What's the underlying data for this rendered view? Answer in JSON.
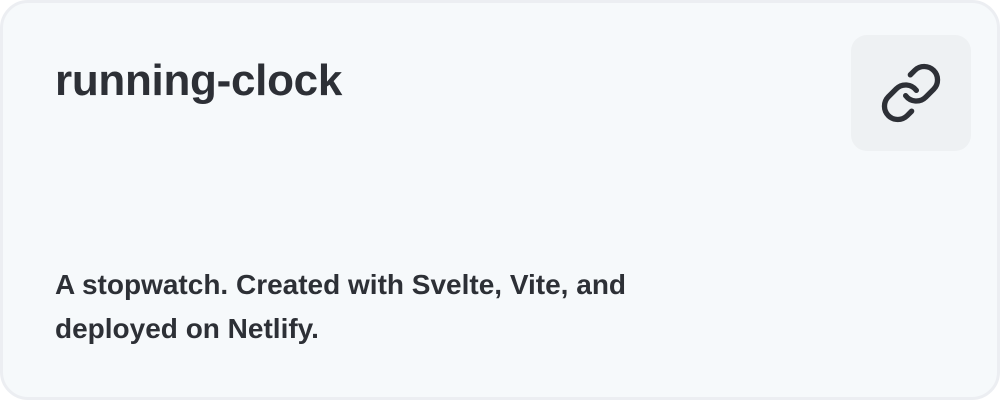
{
  "card": {
    "title": "running-clock",
    "description": "A stopwatch. Created with Svelte, Vite, and deployed on Netlify.",
    "link_icon": "link-icon"
  },
  "colors": {
    "card_background": "#f6f9fb",
    "card_border": "#eceef2",
    "button_background": "#eef1f3",
    "text": "#2d3036"
  }
}
